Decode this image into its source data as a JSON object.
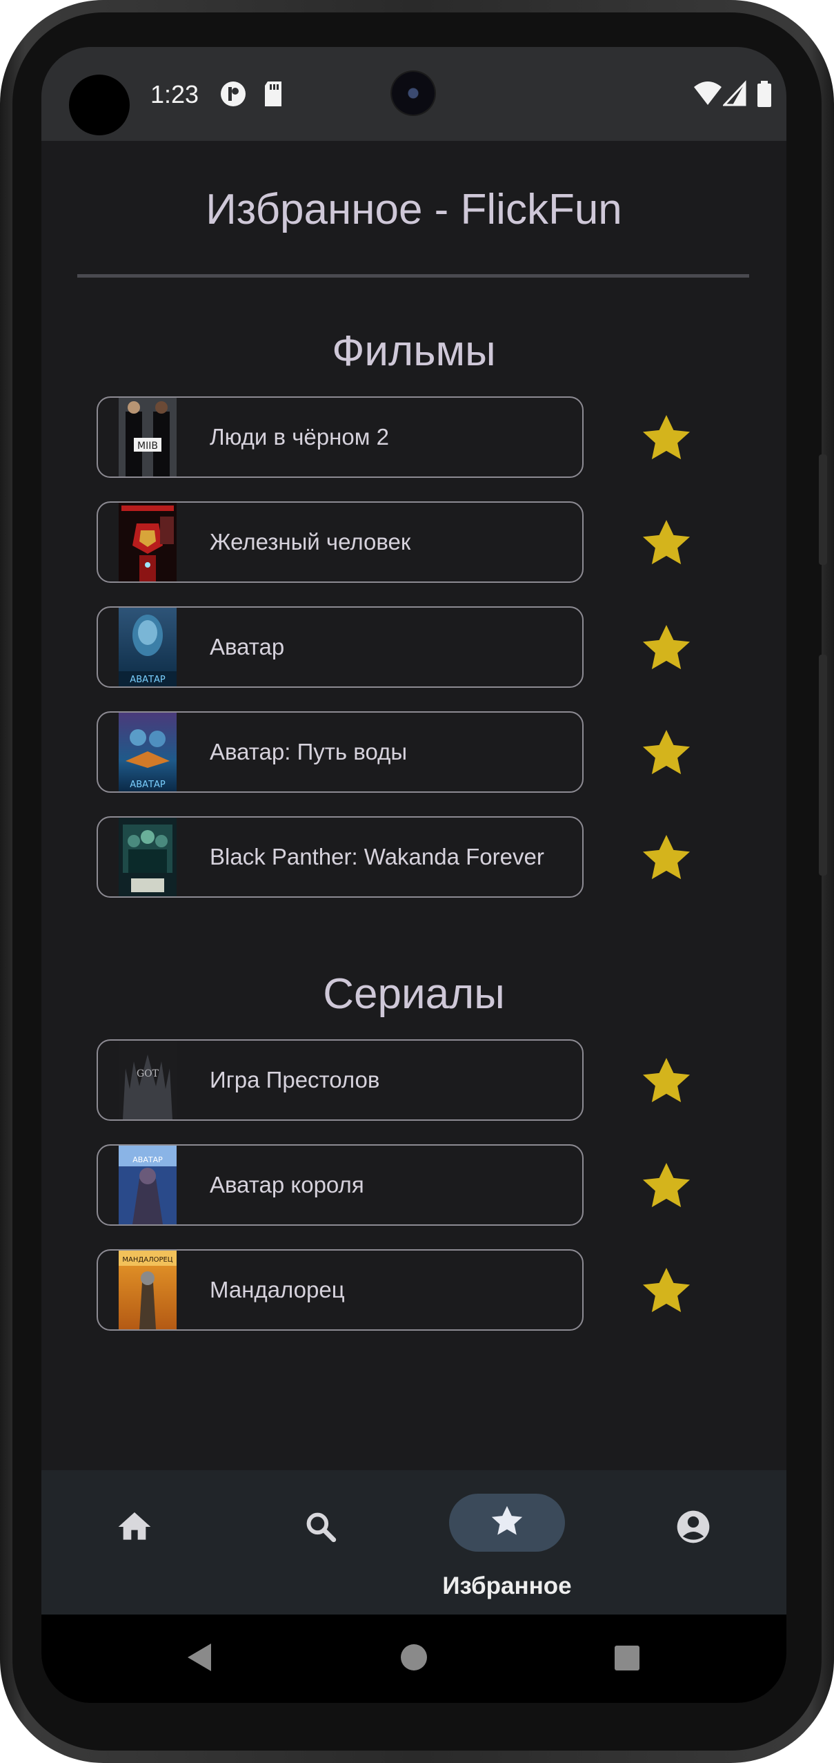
{
  "status_bar": {
    "time": "1:23"
  },
  "app": {
    "title": "Избранное - FlickFun"
  },
  "sections": {
    "movies": {
      "title": "Фильмы",
      "items": [
        {
          "title": "Люди в чёрном 2",
          "poster_icon": "movie-poster-mib2"
        },
        {
          "title": "Железный человек",
          "poster_icon": "movie-poster-iron-man"
        },
        {
          "title": "Аватар",
          "poster_icon": "movie-poster-avatar"
        },
        {
          "title": "Аватар: Путь воды",
          "poster_icon": "movie-poster-avatar-way-of-water"
        },
        {
          "title": "Black Panther: Wakanda Forever",
          "poster_icon": "movie-poster-black-panther"
        }
      ]
    },
    "series": {
      "title": "Сериалы",
      "items": [
        {
          "title": "Игра Престолов",
          "poster_icon": "series-poster-got"
        },
        {
          "title": "Аватар короля",
          "poster_icon": "series-poster-king-avatar"
        },
        {
          "title": "Мандалорец",
          "poster_icon": "series-poster-mandalorian"
        }
      ]
    }
  },
  "bottom_nav": {
    "items": [
      {
        "icon": "home-icon",
        "label": ""
      },
      {
        "icon": "search-icon",
        "label": ""
      },
      {
        "icon": "star-icon",
        "label": "Избранное",
        "active": true
      },
      {
        "icon": "account-icon",
        "label": ""
      }
    ]
  },
  "colors": {
    "background": "#1b1b1d",
    "status_bar": "#2e2f31",
    "star": "#d4b41c",
    "card_border": "#8d8b93",
    "nav_background": "#212529",
    "nav_active_pill": "#3b4a5a"
  }
}
